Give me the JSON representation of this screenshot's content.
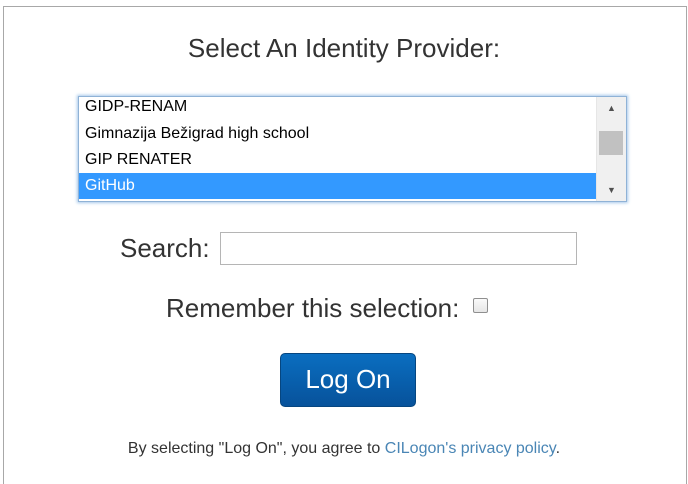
{
  "title": "Select An Identity Provider:",
  "idp_list": {
    "items": [
      {
        "label": "GIDP-RENAM"
      },
      {
        "label": "Gimnazija Bežigrad high school"
      },
      {
        "label": "GIP RENATER"
      },
      {
        "label": "GitHub"
      }
    ],
    "selected": "GitHub",
    "scroll_up_glyph": "▲",
    "scroll_down_glyph": "▼"
  },
  "search": {
    "label": "Search:",
    "value": "",
    "placeholder": ""
  },
  "remember": {
    "label": "Remember this selection:",
    "checked": false
  },
  "logon_button": {
    "label": "Log On"
  },
  "agreement": {
    "prefix": "By selecting \"Log On\", you agree to ",
    "link_text": "CILogon's privacy policy",
    "suffix": "."
  },
  "colors": {
    "accent_button": "#07529b",
    "selection": "#3399ff",
    "link": "#4a86b5"
  },
  "icons": {
    "scroll_up": "chevron-up-icon",
    "scroll_down": "chevron-down-icon",
    "checkbox": "checkbox-icon"
  }
}
